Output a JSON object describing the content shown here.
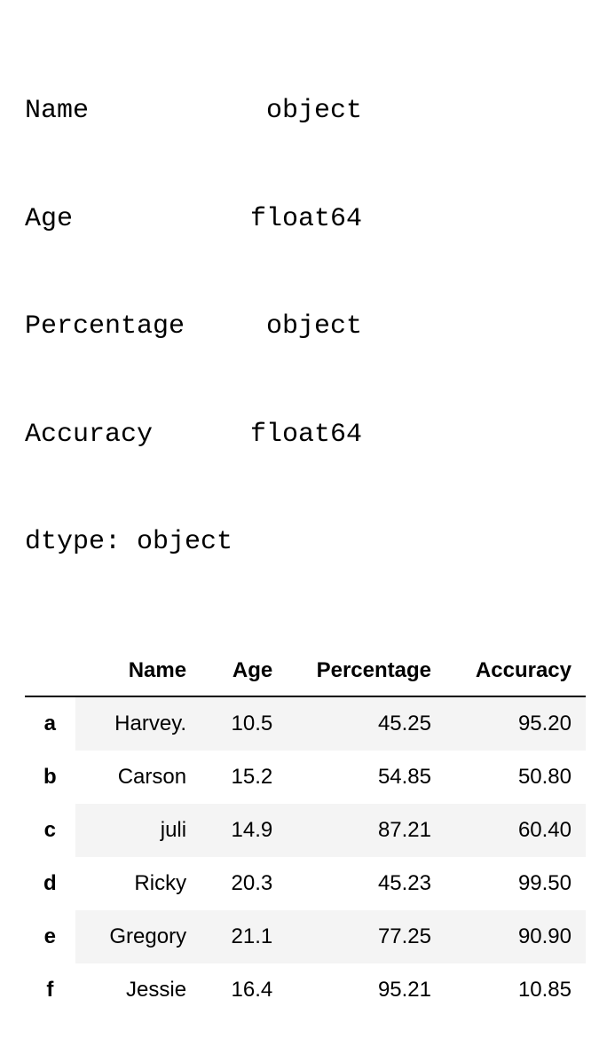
{
  "dtypes": {
    "rows": [
      {
        "label": "Name",
        "value": "object"
      },
      {
        "label": "Age",
        "value": "float64"
      },
      {
        "label": "Percentage",
        "value": "object"
      },
      {
        "label": "Accuracy",
        "value": "float64"
      }
    ],
    "footer": "dtype: object"
  },
  "table": {
    "columns": [
      "Name",
      "Age",
      "Percentage",
      "Accuracy"
    ],
    "rows": [
      {
        "index": "a",
        "Name": "Harvey.",
        "Age": "10.5",
        "Percentage": "45.25",
        "Accuracy": "95.20"
      },
      {
        "index": "b",
        "Name": "Carson",
        "Age": "15.2",
        "Percentage": "54.85",
        "Accuracy": "50.80"
      },
      {
        "index": "c",
        "Name": "juli",
        "Age": "14.9",
        "Percentage": "87.21",
        "Accuracy": "60.40"
      },
      {
        "index": "d",
        "Name": "Ricky",
        "Age": "20.3",
        "Percentage": "45.23",
        "Accuracy": "99.50"
      },
      {
        "index": "e",
        "Name": "Gregory",
        "Age": "21.1",
        "Percentage": "77.25",
        "Accuracy": "90.90"
      },
      {
        "index": "f",
        "Name": "Jessie",
        "Age": "16.4",
        "Percentage": "95.21",
        "Accuracy": "10.85"
      }
    ]
  }
}
